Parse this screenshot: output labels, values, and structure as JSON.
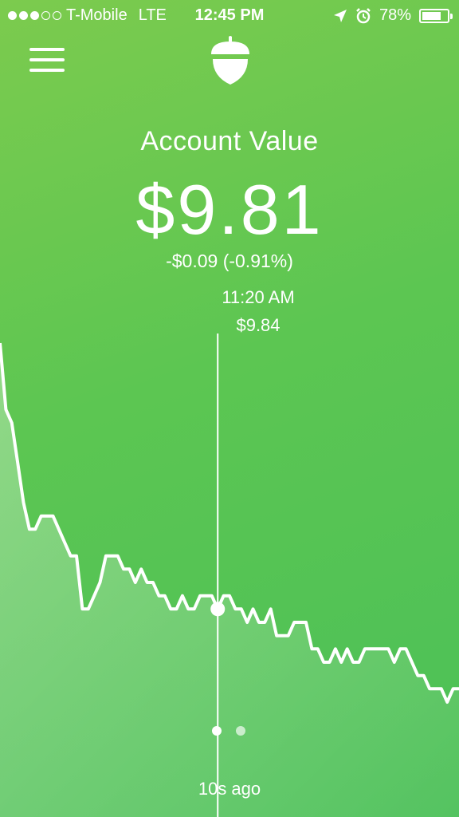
{
  "status_bar": {
    "carrier": "T-Mobile",
    "network": "LTE",
    "time": "12:45 PM",
    "battery": "78%",
    "battery_level": 0.78,
    "signal_bars": 3,
    "icons": [
      "location-arrow-icon",
      "alarm-clock-icon",
      "battery-icon"
    ]
  },
  "header": {
    "menu_icon": "hamburger-menu-icon",
    "logo_icon": "acorn-logo-icon"
  },
  "account": {
    "title": "Account Value",
    "value": "$9.81",
    "change": "-$0.09 (-0.91%)"
  },
  "scrubber": {
    "time": "11:20 AM",
    "price": "$9.84"
  },
  "chart_data": {
    "type": "area",
    "values": [
      10.05,
      10.0,
      9.99,
      9.96,
      9.93,
      9.91,
      9.91,
      9.92,
      9.92,
      9.92,
      9.91,
      9.9,
      9.89,
      9.89,
      9.85,
      9.85,
      9.86,
      9.87,
      9.89,
      9.89,
      9.89,
      9.88,
      9.88,
      9.87,
      9.88,
      9.87,
      9.87,
      9.86,
      9.86,
      9.85,
      9.85,
      9.86,
      9.85,
      9.85,
      9.86,
      9.86,
      9.86,
      9.85,
      9.86,
      9.86,
      9.85,
      9.85,
      9.84,
      9.85,
      9.84,
      9.84,
      9.85,
      9.83,
      9.83,
      9.83,
      9.84,
      9.84,
      9.84,
      9.82,
      9.82,
      9.81,
      9.81,
      9.82,
      9.81,
      9.82,
      9.81,
      9.81,
      9.82,
      9.82,
      9.82,
      9.82,
      9.82,
      9.81,
      9.82,
      9.82,
      9.81,
      9.8,
      9.8,
      9.79,
      9.79,
      9.79,
      9.78,
      9.79,
      9.79
    ],
    "highlight_index": 37,
    "highlight_value": 9.84,
    "grid": false,
    "legend": "none"
  },
  "pager": {
    "count": 2,
    "active": 0
  },
  "footer": {
    "updated": "10s ago"
  }
}
